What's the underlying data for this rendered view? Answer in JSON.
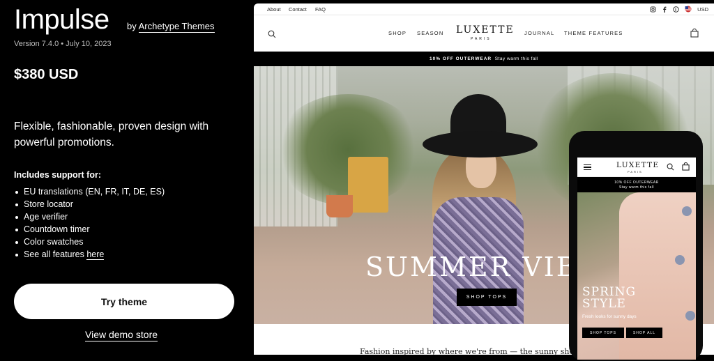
{
  "theme": {
    "name": "Impulse",
    "by_prefix": "by",
    "author": "Archetype Themes",
    "version_line": "Version 7.4.0 • July 10, 2023",
    "price": "$380 USD",
    "tagline": "Flexible, fashionable, proven design with powerful promotions.",
    "includes_title": "Includes support for:",
    "features": [
      "EU translations (EN, FR, IT, DE, ES)",
      "Store locator",
      "Age verifier",
      "Countdown timer",
      "Color swatches"
    ],
    "see_all_prefix": "See all features ",
    "see_all_link": "here",
    "try_button": "Try theme",
    "demo_link": "View demo store"
  },
  "desktop_preview": {
    "util_links": [
      "About",
      "Contact",
      "FAQ"
    ],
    "currency": "USD",
    "nav_left": [
      "SHOP",
      "SEASON"
    ],
    "nav_right": [
      "JOURNAL",
      "THEME FEATURES"
    ],
    "logo": "LUXETTE",
    "logo_sub": "PARIS",
    "promo_bold": "10% OFF OUTERWEAR",
    "promo_text": "Stay warm this fall",
    "hero_text": "SUMMER VIB",
    "hero_button": "SHOP TOPS",
    "body_text": "Fashion inspired by where we're from — the sunny shores"
  },
  "mobile_preview": {
    "logo": "LUXETTE",
    "logo_sub": "PARIS",
    "promo_bold": "10% OFF OUTERWEAR",
    "promo_text": "Stay warm this fall",
    "hero_line1": "SPRING",
    "hero_line2": "STYLE",
    "hero_sub": "Fresh looks for sunny days",
    "btn_tops": "SHOP TOPS",
    "btn_all": "SHOP ALL"
  }
}
